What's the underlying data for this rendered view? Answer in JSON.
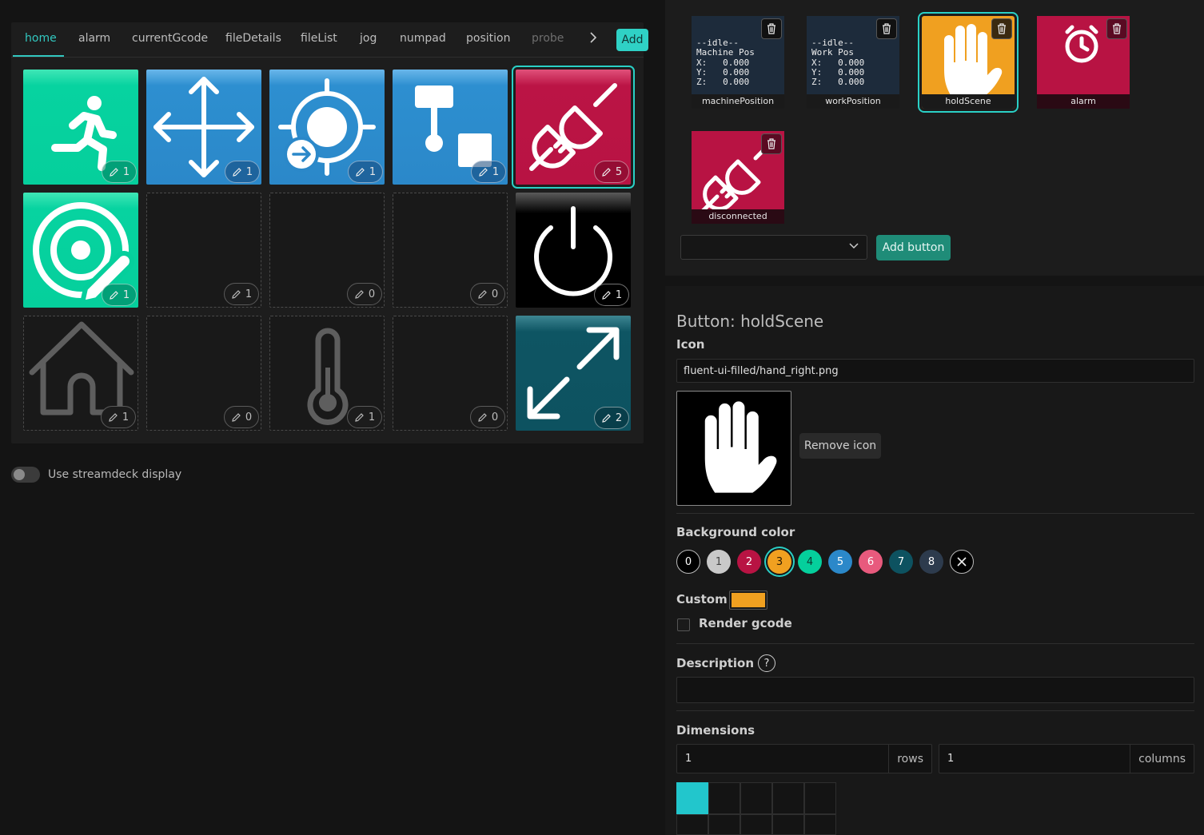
{
  "tabs": {
    "items": [
      {
        "label": "home",
        "active": true
      },
      {
        "label": "alarm"
      },
      {
        "label": "currentGcode"
      },
      {
        "label": "fileDetails"
      },
      {
        "label": "fileList"
      },
      {
        "label": "jog"
      },
      {
        "label": "numpad"
      },
      {
        "label": "position"
      },
      {
        "label": "probe"
      }
    ],
    "add_label": "Add"
  },
  "grid": [
    {
      "icon": "running-person-icon",
      "color": "green",
      "count": "1"
    },
    {
      "icon": "move-arrows-icon",
      "color": "blue",
      "count": "1"
    },
    {
      "icon": "target-arrow-icon",
      "color": "blue",
      "count": "1"
    },
    {
      "icon": "probe-icon",
      "color": "blue",
      "count": "1"
    },
    {
      "icon": "plug-disconnected-icon",
      "color": "red",
      "count": "5",
      "selected": true
    },
    {
      "icon": "target-edit-icon",
      "color": "green",
      "count": "1"
    },
    {
      "icon": "",
      "color": "empty",
      "count": "1"
    },
    {
      "icon": "",
      "color": "empty",
      "count": "0"
    },
    {
      "icon": "",
      "color": "empty",
      "count": "0"
    },
    {
      "icon": "power-icon",
      "color": "black",
      "count": "1"
    },
    {
      "icon": "home-icon",
      "color": "empty",
      "count": "1"
    },
    {
      "icon": "",
      "color": "empty",
      "count": "0"
    },
    {
      "icon": "thermometer-icon",
      "color": "empty",
      "count": "1"
    },
    {
      "icon": "",
      "color": "empty",
      "count": "0"
    },
    {
      "icon": "expand-arrows-icon",
      "color": "teal",
      "count": "2"
    }
  ],
  "streamdeck_toggle": {
    "label": "Use streamdeck display",
    "on": false
  },
  "scenes": [
    {
      "label": "machinePosition",
      "lines": [
        "--idle--",
        "Machine Pos",
        "X:   0.000",
        "Y:   0.000",
        "Z:   0.000"
      ]
    },
    {
      "label": "workPosition",
      "lines": [
        "--idle--",
        "Work Pos",
        "X:   0.000",
        "Y:   0.000",
        "Z:   0.000"
      ]
    },
    {
      "label": "holdScene",
      "icon": "hand-icon",
      "color": "#f0a020",
      "selected": true
    },
    {
      "label": "alarm",
      "icon": "alarm-clock-icon",
      "color": "#b81343"
    },
    {
      "label": "disconnected",
      "icon": "plug-disconnected-icon",
      "color": "#b81343"
    }
  ],
  "scene_select": {
    "value": ""
  },
  "add_button_label": "Add button",
  "editor": {
    "title": "Button: holdScene",
    "icon_label": "Icon",
    "icon_path": "fluent-ui-filled/hand_right.png",
    "remove_icon_label": "Remove icon",
    "bg_label": "Background color",
    "swatches": [
      {
        "label": "0",
        "color": "#000000",
        "text": "#ffffff"
      },
      {
        "label": "1",
        "color": "#c9c9c9",
        "text": "#444444"
      },
      {
        "label": "2",
        "color": "#b81343",
        "text": "#ffffff"
      },
      {
        "label": "3",
        "color": "#f0a020",
        "text": "#2a1a00",
        "selected": true
      },
      {
        "label": "4",
        "color": "#05cf9c",
        "text": "#0b3a30"
      },
      {
        "label": "5",
        "color": "#2b88c9",
        "text": "#ffffff"
      },
      {
        "label": "6",
        "color": "#e85a7d",
        "text": "#ffffff"
      },
      {
        "label": "7",
        "color": "#0d5260",
        "text": "#ffffff"
      },
      {
        "label": "8",
        "color": "#2d3b4d",
        "text": "#ffffff"
      }
    ],
    "custom_label": "Custom",
    "custom_color": "#f0a020",
    "render_gcode_label": "Render gcode",
    "description_label": "Description",
    "description_value": "",
    "dimensions_label": "Dimensions",
    "rows_value": "1",
    "rows_suffix": "rows",
    "columns_value": "1",
    "columns_suffix": "columns"
  }
}
